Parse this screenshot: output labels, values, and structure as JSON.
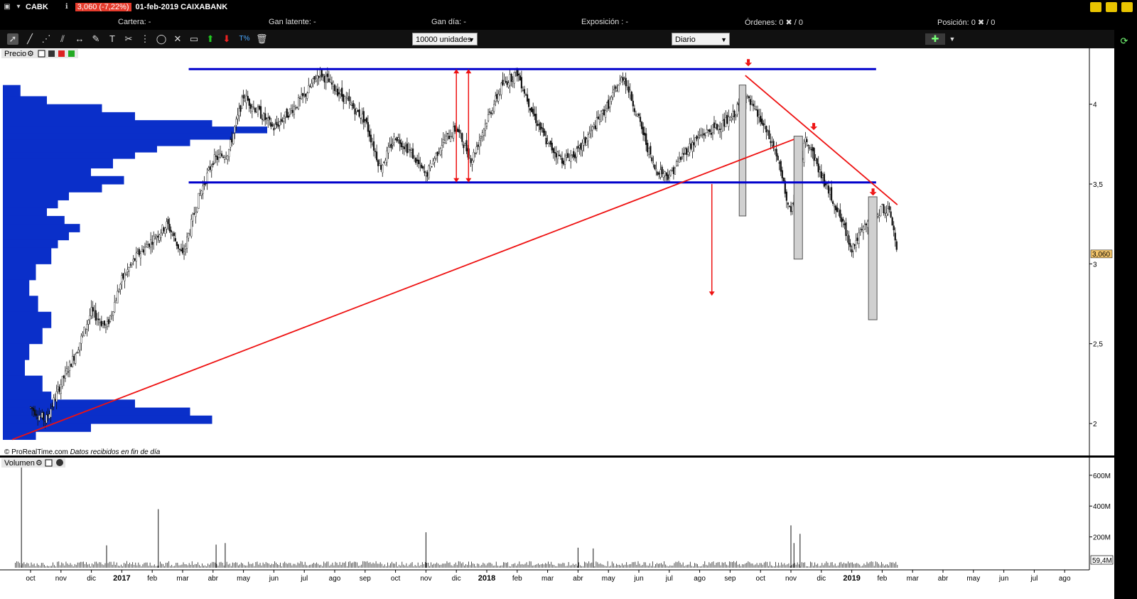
{
  "titlebar": {
    "ticker": "CABK",
    "change": "3,060 (-7,22%)",
    "title": "01-feb-2019 CAIXABANK"
  },
  "infobar": {
    "cartera": "Cartera: -",
    "gan_latente": "Gan latente: -",
    "gan_dia": "Gan día: -",
    "exposicion": "Exposición : -",
    "ordenes": "Órdenes: 0 ✖ / 0",
    "posicion": "Posición: 0 ✖ / 0"
  },
  "toolbar": {
    "units_select": "10000 unidades",
    "period_select": "Diario",
    "pct_tool": "T%"
  },
  "price_panel": {
    "label": "Precio",
    "footer": "© ProRealTime.com",
    "footer_italic": "Datos recibidos en fin de día",
    "last_value": "3,060"
  },
  "volume_panel": {
    "label": "Volumen",
    "last_value": "59,4M"
  },
  "colors": {
    "channel": "#0000cc",
    "trend": "#ee1111",
    "profile": "#0a2fc9",
    "bg": "#ffffff"
  },
  "chart_data": {
    "type": "candlestick",
    "price_axis": {
      "ticks": [
        2,
        2.5,
        3,
        3.5,
        4
      ],
      "tick_labels": [
        "2",
        "2,5",
        "3",
        "3,5",
        "4"
      ],
      "range": [
        1.8,
        4.35
      ]
    },
    "volume_axis": {
      "ticks": [
        200,
        400,
        600
      ],
      "tick_labels": [
        "200M",
        "400M",
        "600M"
      ],
      "range": [
        0,
        650
      ]
    },
    "x_labels": [
      {
        "t": "oct",
        "m": 0
      },
      {
        "t": "nov",
        "m": 1
      },
      {
        "t": "dic",
        "m": 2
      },
      {
        "t": "2017",
        "m": 3,
        "bold": true
      },
      {
        "t": "feb",
        "m": 4
      },
      {
        "t": "mar",
        "m": 5
      },
      {
        "t": "abr",
        "m": 6
      },
      {
        "t": "may",
        "m": 7
      },
      {
        "t": "jun",
        "m": 8
      },
      {
        "t": "jul",
        "m": 9
      },
      {
        "t": "ago",
        "m": 10
      },
      {
        "t": "sep",
        "m": 11
      },
      {
        "t": "oct",
        "m": 12
      },
      {
        "t": "nov",
        "m": 13
      },
      {
        "t": "dic",
        "m": 14
      },
      {
        "t": "2018",
        "m": 15,
        "bold": true
      },
      {
        "t": "feb",
        "m": 16
      },
      {
        "t": "mar",
        "m": 17
      },
      {
        "t": "abr",
        "m": 18
      },
      {
        "t": "may",
        "m": 19
      },
      {
        "t": "jun",
        "m": 20
      },
      {
        "t": "jul",
        "m": 21
      },
      {
        "t": "ago",
        "m": 22
      },
      {
        "t": "sep",
        "m": 23
      },
      {
        "t": "oct",
        "m": 24
      },
      {
        "t": "nov",
        "m": 25
      },
      {
        "t": "dic",
        "m": 26
      },
      {
        "t": "2019",
        "m": 27,
        "bold": true
      },
      {
        "t": "feb",
        "m": 28
      },
      {
        "t": "mar",
        "m": 29
      },
      {
        "t": "abr",
        "m": 30
      },
      {
        "t": "may",
        "m": 31
      },
      {
        "t": "jun",
        "m": 32
      },
      {
        "t": "jul",
        "m": 33
      },
      {
        "t": "ago",
        "m": 34
      }
    ],
    "price_path": [
      [
        0,
        2.1
      ],
      [
        0.5,
        2.02
      ],
      [
        1,
        2.25
      ],
      [
        1.5,
        2.45
      ],
      [
        2,
        2.7
      ],
      [
        2.5,
        2.6
      ],
      [
        3,
        2.9
      ],
      [
        3.5,
        3.05
      ],
      [
        4,
        3.15
      ],
      [
        4.5,
        3.25
      ],
      [
        5,
        3.05
      ],
      [
        5.5,
        3.4
      ],
      [
        6,
        3.65
      ],
      [
        6.5,
        3.7
      ],
      [
        7,
        4.05
      ],
      [
        7.5,
        3.95
      ],
      [
        8,
        3.85
      ],
      [
        8.5,
        3.95
      ],
      [
        9,
        4.05
      ],
      [
        9.5,
        4.2
      ],
      [
        10,
        4.1
      ],
      [
        10.5,
        4.0
      ],
      [
        11,
        3.9
      ],
      [
        11.5,
        3.6
      ],
      [
        12,
        3.8
      ],
      [
        12.5,
        3.7
      ],
      [
        13,
        3.55
      ],
      [
        13.5,
        3.75
      ],
      [
        14,
        3.85
      ],
      [
        14.5,
        3.65
      ],
      [
        15,
        3.9
      ],
      [
        15.5,
        4.12
      ],
      [
        16,
        4.2
      ],
      [
        16.5,
        3.95
      ],
      [
        17,
        3.75
      ],
      [
        17.5,
        3.65
      ],
      [
        18,
        3.7
      ],
      [
        18.5,
        3.85
      ],
      [
        19,
        4.0
      ],
      [
        19.5,
        4.18
      ],
      [
        20,
        3.9
      ],
      [
        20.5,
        3.6
      ],
      [
        21,
        3.55
      ],
      [
        21.5,
        3.7
      ],
      [
        22,
        3.8
      ],
      [
        22.5,
        3.85
      ],
      [
        23,
        3.9
      ],
      [
        23.5,
        4.05
      ],
      [
        24,
        3.9
      ],
      [
        24.5,
        3.7
      ],
      [
        25,
        3.3
      ],
      [
        25.5,
        3.8
      ],
      [
        26,
        3.55
      ],
      [
        26.5,
        3.35
      ],
      [
        27,
        3.1
      ],
      [
        27.5,
        3.25
      ],
      [
        28,
        3.35
      ],
      [
        28.3,
        3.3
      ],
      [
        28.5,
        3.06
      ]
    ],
    "volume_spikes": [
      {
        "m": -0.3,
        "v": 650
      },
      {
        "m": 2.5,
        "v": 145
      },
      {
        "m": 4.2,
        "v": 380
      },
      {
        "m": 6.1,
        "v": 150
      },
      {
        "m": 6.4,
        "v": 160
      },
      {
        "m": 13.0,
        "v": 230
      },
      {
        "m": 18.0,
        "v": 130
      },
      {
        "m": 18.5,
        "v": 125
      },
      {
        "m": 25.0,
        "v": 275
      },
      {
        "m": 25.3,
        "v": 220
      },
      {
        "m": 25.1,
        "v": 160
      }
    ],
    "channel": {
      "top": 4.22,
      "bottom": 3.51,
      "x_start": 5.2,
      "x_end": 27.8
    },
    "trendline_up": {
      "from": [
        -0.6,
        1.9
      ],
      "to": [
        25.1,
        3.78
      ]
    },
    "trendline_down": {
      "from": [
        23.5,
        4.18
      ],
      "to": [
        28.5,
        3.37
      ]
    },
    "target_arrow": {
      "x": 22.4,
      "from": 3.5,
      "to": 2.8
    },
    "range_arrows": [
      {
        "x": 14.0,
        "from": 4.22,
        "to": 3.51
      },
      {
        "x": 14.4,
        "from": 4.22,
        "to": 3.51
      }
    ],
    "grey_boxes": [
      {
        "x": 23.3,
        "w": 0.22,
        "top": 4.12,
        "bottom": 3.3
      },
      {
        "x": 25.1,
        "w": 0.28,
        "top": 3.8,
        "bottom": 3.03
      },
      {
        "x": 27.55,
        "w": 0.28,
        "top": 3.42,
        "bottom": 2.65
      }
    ],
    "down_markers": [
      {
        "x": 23.6,
        "y": 4.22
      },
      {
        "x": 25.75,
        "y": 3.82
      },
      {
        "x": 27.7,
        "y": 3.41
      }
    ],
    "volume_profile": [
      [
        4.12,
        8
      ],
      [
        4.05,
        20
      ],
      [
        4.0,
        45
      ],
      [
        3.95,
        60
      ],
      [
        3.9,
        95
      ],
      [
        3.86,
        120
      ],
      [
        3.82,
        105
      ],
      [
        3.78,
        85
      ],
      [
        3.74,
        70
      ],
      [
        3.7,
        60
      ],
      [
        3.66,
        50
      ],
      [
        3.6,
        40
      ],
      [
        3.55,
        55
      ],
      [
        3.5,
        45
      ],
      [
        3.45,
        30
      ],
      [
        3.4,
        25
      ],
      [
        3.35,
        20
      ],
      [
        3.3,
        28
      ],
      [
        3.25,
        35
      ],
      [
        3.2,
        30
      ],
      [
        3.15,
        25
      ],
      [
        3.1,
        22
      ],
      [
        3.0,
        15
      ],
      [
        2.9,
        12
      ],
      [
        2.8,
        16
      ],
      [
        2.7,
        22
      ],
      [
        2.6,
        18
      ],
      [
        2.5,
        12
      ],
      [
        2.4,
        10
      ],
      [
        2.3,
        18
      ],
      [
        2.2,
        22
      ],
      [
        2.15,
        60
      ],
      [
        2.1,
        85
      ],
      [
        2.05,
        95
      ],
      [
        2.0,
        40
      ],
      [
        1.95,
        15
      ]
    ]
  }
}
